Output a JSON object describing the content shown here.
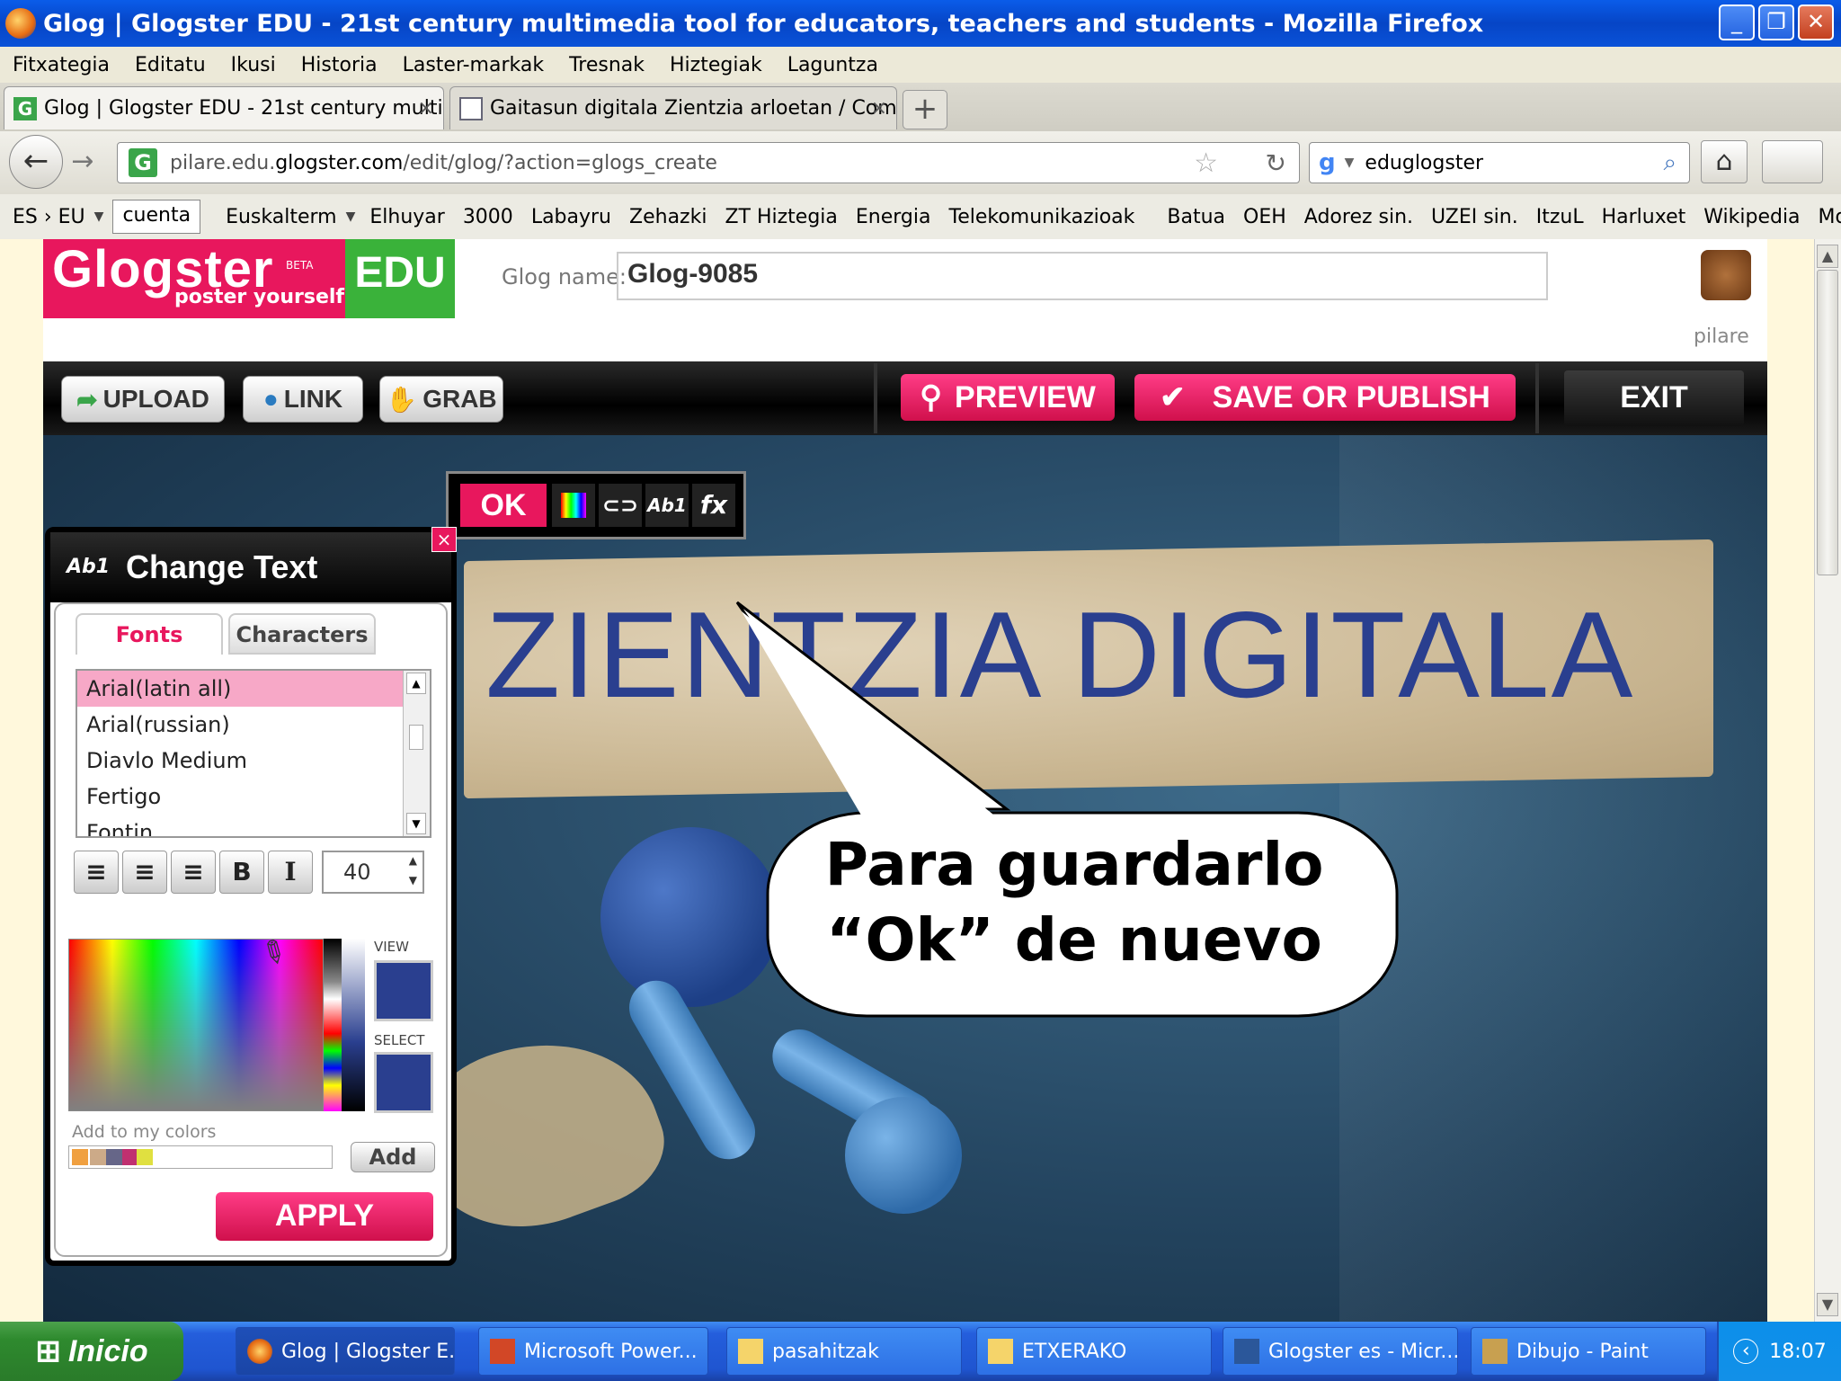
{
  "window": {
    "title": "Glog | Glogster EDU - 21st century multimedia tool for educators, teachers and students - Mozilla Firefox",
    "minimize_icon": "minimize-icon",
    "maximize_icon": "restore-icon",
    "close_icon": "close-icon"
  },
  "menu": [
    "Fitxategia",
    "Editatu",
    "Ikusi",
    "Historia",
    "Laster-markak",
    "Tresnak",
    "Hiztegiak",
    "Laguntza"
  ],
  "tabs": [
    {
      "label": "Glog | Glogster EDU - 21st century multim...",
      "close": "×"
    },
    {
      "label": "Gaitasun digitala Zientzia arloetan / Com...",
      "close": "×"
    }
  ],
  "newtab_label": "+",
  "nav": {
    "back": "←",
    "forward": "→",
    "url_prefix": "pilare.edu.",
    "url_domain": "glogster.com",
    "url_path": "/edit/glog/?action=glogs_create",
    "search_value": "eduglogster",
    "home": "⌂"
  },
  "bookmarks": {
    "lang": "ES › EU",
    "field": "cuenta",
    "items": [
      "Euskalterm",
      "Elhuyar",
      "3000",
      "Labayru",
      "Zehazki",
      "ZT Hiztegia",
      "Energia",
      "Telekomunikazioak",
      "Batua",
      "OEH",
      "Adorez sin.",
      "UZEI sin.",
      "ItzuL",
      "Harluxet",
      "Wikipedia",
      "Mol"
    ]
  },
  "glogster": {
    "logo": "Glogster",
    "logo_sub": "poster yourself",
    "logo_beta": "BETA",
    "logo_edu": "EDU",
    "name_label": "Glog name:",
    "name_value": "Glog-9085",
    "user": "pilare",
    "toolbar": {
      "upload": "UPLOAD",
      "link": "LINK",
      "grab": "GRAB",
      "preview": "PREVIEW",
      "save": "SAVE OR PUBLISH",
      "exit": "EXIT"
    },
    "mini": {
      "ok": "OK",
      "ab": "Ab1",
      "fx": "fx"
    },
    "headline": "ZIENTZIA DIGITALA"
  },
  "change_text": {
    "title": "Change Text",
    "icon": "Ab1",
    "tab_fonts": "Fonts",
    "tab_chars": "Characters",
    "fonts": [
      "Arial(latin all)",
      "Arial(russian)",
      "Diavlo Medium",
      "Fertigo",
      "Fontin"
    ],
    "selected_font": "Arial(latin all)",
    "bold": "B",
    "italic": "I",
    "size": "40",
    "view_label": "VIEW",
    "select_label": "SELECT",
    "add_label": "Add to my colors",
    "add_btn": "Add",
    "apply": "APPLY",
    "color": "#2a3f8f"
  },
  "bubble": {
    "line1": "Para guardarlo",
    "line2": "“Ok” de nuevo"
  },
  "taskbar": {
    "start": "Inicio",
    "tasks": [
      "Glog | Glogster E...",
      "Microsoft Power...",
      "pasahitzak",
      "ETXERAKO",
      "Glogster es - Micr...",
      "Dibujo - Paint"
    ],
    "time": "18:07"
  }
}
